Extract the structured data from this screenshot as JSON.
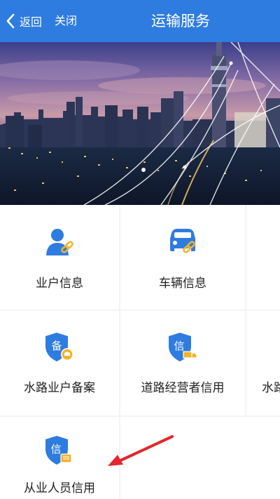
{
  "navbar": {
    "back_label": "返回",
    "close_label": "关闭",
    "title": "运输服务"
  },
  "colors": {
    "accent": "#2f7ce0",
    "icon_blue": "#2f7ce0",
    "icon_gold": "#f4b32c",
    "arrow_red": "#e3262f"
  },
  "grid": {
    "items": [
      {
        "label": "业户信息",
        "icon": "person-link-icon"
      },
      {
        "label": "车辆信息",
        "icon": "car-link-icon"
      },
      {
        "label": "",
        "icon": ""
      },
      {
        "label": "水路业户备案",
        "icon": "shield-bei-icon"
      },
      {
        "label": "道路经营者信用",
        "icon": "shield-xin-truck-icon"
      },
      {
        "label": "水路",
        "icon": ""
      },
      {
        "label": "从业人员信用",
        "icon": "shield-xin-person-icon"
      }
    ]
  },
  "icon_text": {
    "bei": "备",
    "xin": "信"
  }
}
